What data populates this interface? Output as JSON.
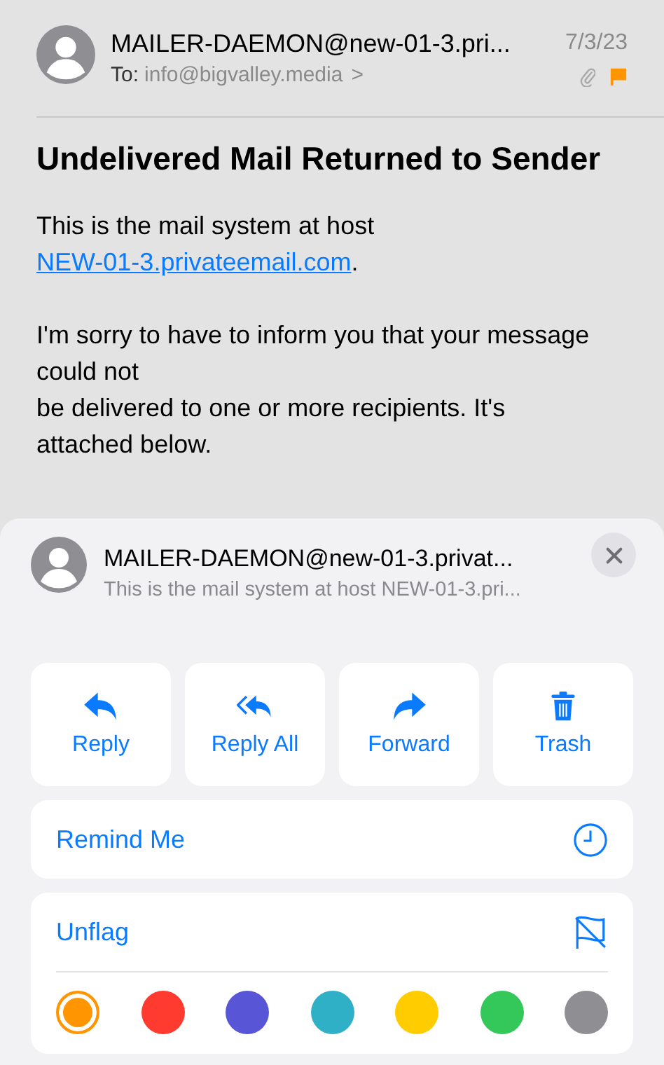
{
  "message": {
    "sender": "MAILER-DAEMON@new-01-3.pri...",
    "date": "7/3/23",
    "to_label": "To:",
    "to": "info@bigvalley.media",
    "chevron": ">",
    "has_attachment": true,
    "flagged": true,
    "subject": "Undelivered Mail Returned to Sender",
    "paragraphs": [
      {
        "lines": [
          "This is the mail system at host"
        ],
        "link": "NEW-01-3.privateemail.com",
        "after_link": "."
      },
      {
        "lines": [
          "I'm sorry to have to inform you that your message could not",
          "be delivered to one or more recipients. It's attached below."
        ]
      }
    ]
  },
  "sheet": {
    "sender": "MAILER-DAEMON@new-01-3.privat...",
    "preview": "This is the mail system at host NEW-01-3.pri...",
    "actions": [
      {
        "kind": "reply",
        "label": "Reply"
      },
      {
        "kind": "reply_all",
        "label": "Reply All"
      },
      {
        "kind": "forward",
        "label": "Forward"
      },
      {
        "kind": "trash",
        "label": "Trash"
      }
    ],
    "remind": {
      "label": "Remind Me"
    },
    "flag": {
      "label": "Unflag"
    },
    "flag_colors": [
      {
        "color": "#ff9500",
        "selected": true
      },
      {
        "color": "#ff3b30",
        "selected": false
      },
      {
        "color": "#5856d6",
        "selected": false
      },
      {
        "color": "#30b0c7",
        "selected": false
      },
      {
        "color": "#ffcc00",
        "selected": false
      },
      {
        "color": "#34c759",
        "selected": false
      },
      {
        "color": "#8e8e93",
        "selected": false
      }
    ]
  }
}
